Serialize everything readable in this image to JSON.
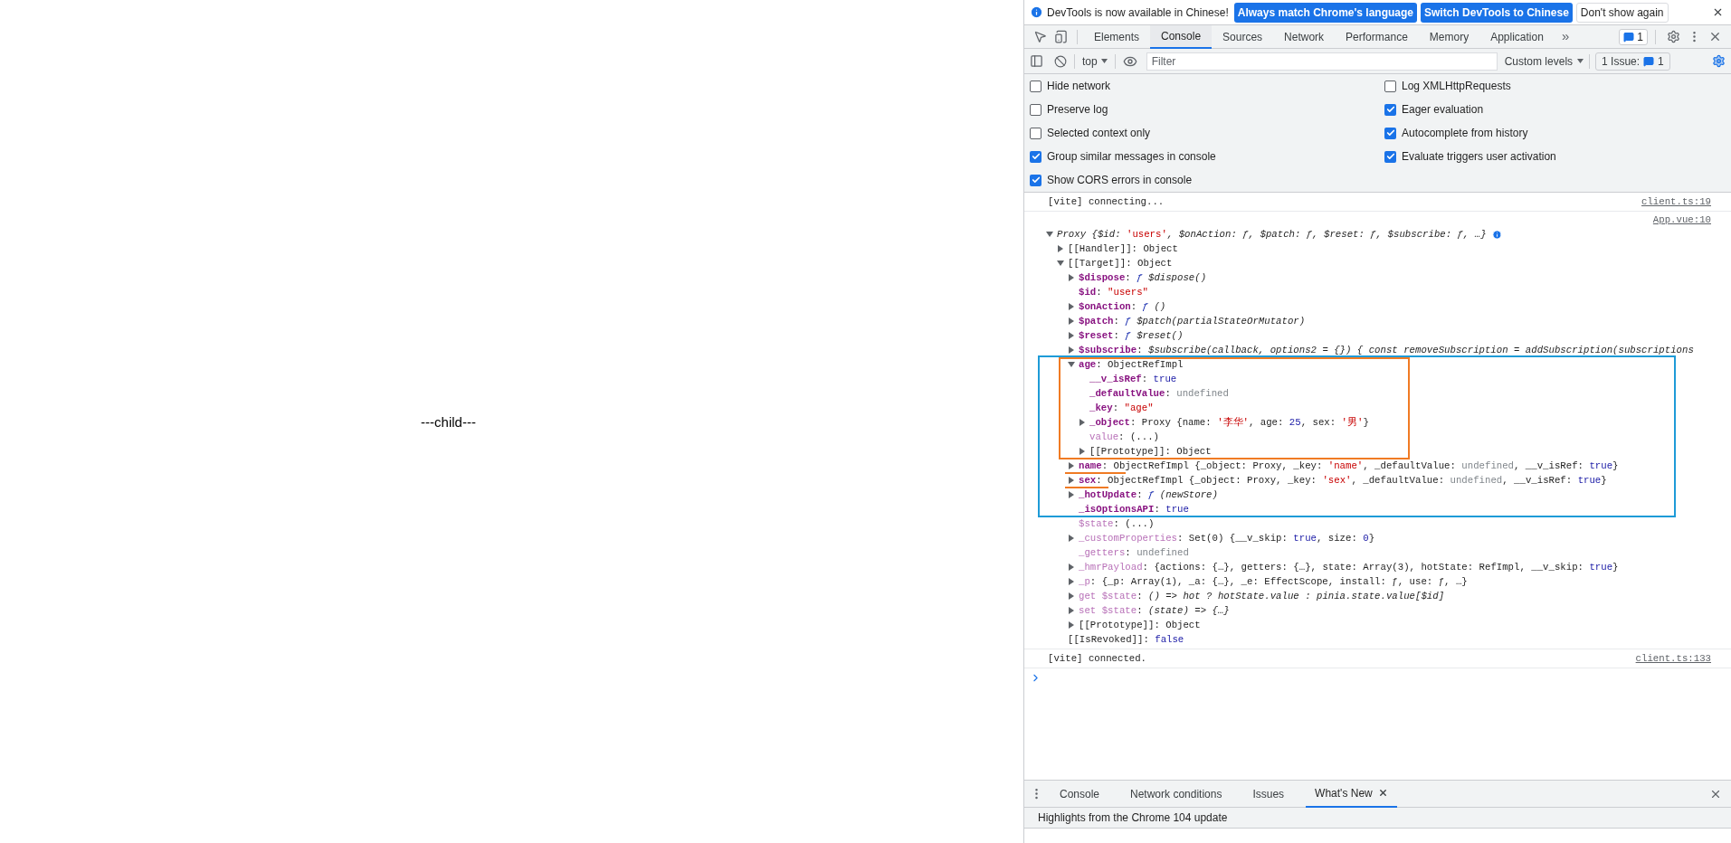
{
  "page": {
    "text": "---child---"
  },
  "devtools": {
    "infobar": {
      "message": "DevTools is now available in Chinese!",
      "buttons": [
        {
          "label": "Always match Chrome's language",
          "kind": "primary"
        },
        {
          "label": "Switch DevTools to Chinese",
          "kind": "primary"
        },
        {
          "label": "Don't show again",
          "kind": "secondary"
        }
      ]
    },
    "tabs": [
      {
        "label": "Elements",
        "selected": false
      },
      {
        "label": "Console",
        "selected": true
      },
      {
        "label": "Sources",
        "selected": false
      },
      {
        "label": "Network",
        "selected": false
      },
      {
        "label": "Performance",
        "selected": false
      },
      {
        "label": "Memory",
        "selected": false
      },
      {
        "label": "Application",
        "selected": false
      }
    ],
    "more_tabs": "»",
    "issues_badge": "1",
    "toolbar": {
      "context": "top",
      "filter_placeholder": "Filter",
      "levels": "Custom levels",
      "issues_label": "1 Issue:",
      "issues_count": "1"
    },
    "settings": {
      "left": [
        {
          "label": "Hide network",
          "checked": false
        },
        {
          "label": "Preserve log",
          "checked": false
        },
        {
          "label": "Selected context only",
          "checked": false
        },
        {
          "label": "Group similar messages in console",
          "checked": true
        },
        {
          "label": "Show CORS errors in console",
          "checked": true
        }
      ],
      "right": [
        {
          "label": "Log XMLHttpRequests",
          "checked": false
        },
        {
          "label": "Eager evaluation",
          "checked": true
        },
        {
          "label": "Autocomplete from history",
          "checked": true
        },
        {
          "label": "Evaluate triggers user activation",
          "checked": true
        }
      ]
    },
    "console": {
      "messages": [
        {
          "kind": "log",
          "text": "[vite] connecting...",
          "source": "client.ts:19"
        },
        {
          "kind": "object",
          "source": "App.vue:10",
          "tree": {
            "kind": "expandable",
            "expanded": true,
            "line": [
              {
                "text": "Proxy {$id: ",
                "kind": "italic"
              },
              {
                "text": "'users'",
                "kind": "string"
              },
              {
                "text": ", $onAction: ƒ, $patch: ƒ, $reset: ƒ, $subscribe: ƒ, …}",
                "kind": "italic"
              }
            ],
            "children": [
              {
                "kind": "expandable",
                "expanded": false,
                "line": [
                  {
                    "text": "[[Handler]]",
                    "kind": "key_internal"
                  },
                  {
                    "text": ": Object",
                    "kind": "plain"
                  }
                ]
              },
              {
                "kind": "expandable",
                "expanded": true,
                "line": [
                  {
                    "text": "[[Target]]",
                    "kind": "key_internal"
                  },
                  {
                    "text": ": Object",
                    "kind": "plain"
                  }
                ],
                "children": [
                  {
                    "kind": "expandable",
                    "expanded": false,
                    "line": [
                      {
                        "text": "$dispose",
                        "kind": "key_own"
                      },
                      {
                        "text": ": ",
                        "kind": "plain"
                      },
                      {
                        "text": "ƒ ",
                        "kind": "fn"
                      },
                      {
                        "text": "$dispose()",
                        "kind": "italic"
                      }
                    ]
                  },
                  {
                    "kind": "leaf",
                    "line": [
                      {
                        "text": "$id",
                        "kind": "key_own"
                      },
                      {
                        "text": ": ",
                        "kind": "plain"
                      },
                      {
                        "text": "\"users\"",
                        "kind": "string"
                      }
                    ]
                  },
                  {
                    "kind": "expandable",
                    "expanded": false,
                    "line": [
                      {
                        "text": "$onAction",
                        "kind": "key_own"
                      },
                      {
                        "text": ": ",
                        "kind": "plain"
                      },
                      {
                        "text": "ƒ ",
                        "kind": "fn"
                      },
                      {
                        "text": "()",
                        "kind": "italic"
                      }
                    ]
                  },
                  {
                    "kind": "expandable",
                    "expanded": false,
                    "line": [
                      {
                        "text": "$patch",
                        "kind": "key_own"
                      },
                      {
                        "text": ": ",
                        "kind": "plain"
                      },
                      {
                        "text": "ƒ ",
                        "kind": "fn"
                      },
                      {
                        "text": "$patch(partialStateOrMutator)",
                        "kind": "italic"
                      }
                    ]
                  },
                  {
                    "kind": "expandable",
                    "expanded": false,
                    "line": [
                      {
                        "text": "$reset",
                        "kind": "key_own"
                      },
                      {
                        "text": ": ",
                        "kind": "plain"
                      },
                      {
                        "text": "ƒ ",
                        "kind": "fn"
                      },
                      {
                        "text": "$reset()",
                        "kind": "italic"
                      }
                    ]
                  },
                  {
                    "kind": "expandable",
                    "expanded": false,
                    "line": [
                      {
                        "text": "$subscribe",
                        "kind": "key_own"
                      },
                      {
                        "text": ": ",
                        "kind": "plain"
                      },
                      {
                        "text": "$subscribe(callback, options2 = {}) { const removeSubscription = addSubscription(subscriptions",
                        "kind": "italic"
                      }
                    ]
                  },
                  {
                    "kind": "expandable",
                    "expanded": true,
                    "line": [
                      {
                        "text": "age",
                        "kind": "key_own"
                      },
                      {
                        "text": ": ObjectRefImpl",
                        "kind": "plain"
                      }
                    ],
                    "children": [
                      {
                        "kind": "leaf",
                        "line": [
                          {
                            "text": "__v_isRef",
                            "kind": "key_own"
                          },
                          {
                            "text": ": ",
                            "kind": "plain"
                          },
                          {
                            "text": "true",
                            "kind": "keyword"
                          }
                        ]
                      },
                      {
                        "kind": "leaf",
                        "line": [
                          {
                            "text": "_defaultValue",
                            "kind": "key_own"
                          },
                          {
                            "text": ": ",
                            "kind": "plain"
                          },
                          {
                            "text": "undefined",
                            "kind": "undefined"
                          }
                        ]
                      },
                      {
                        "kind": "leaf",
                        "line": [
                          {
                            "text": "_key",
                            "kind": "key_own"
                          },
                          {
                            "text": ": ",
                            "kind": "plain"
                          },
                          {
                            "text": "\"age\"",
                            "kind": "string"
                          }
                        ]
                      },
                      {
                        "kind": "expandable",
                        "expanded": false,
                        "line": [
                          {
                            "text": "_object",
                            "kind": "key_own"
                          },
                          {
                            "text": ": Proxy {name: ",
                            "kind": "plain"
                          },
                          {
                            "text": "'李华'",
                            "kind": "string"
                          },
                          {
                            "text": ", age: ",
                            "kind": "plain"
                          },
                          {
                            "text": "25",
                            "kind": "number"
                          },
                          {
                            "text": ", sex: ",
                            "kind": "plain"
                          },
                          {
                            "text": "'男'",
                            "kind": "string"
                          },
                          {
                            "text": "}",
                            "kind": "plain"
                          }
                        ]
                      },
                      {
                        "kind": "leaf",
                        "line": [
                          {
                            "text": "value",
                            "kind": "key_faded"
                          },
                          {
                            "text": ": (...)",
                            "kind": "plain"
                          }
                        ]
                      },
                      {
                        "kind": "expandable",
                        "expanded": false,
                        "line": [
                          {
                            "text": "[[Prototype]]",
                            "kind": "key_internal"
                          },
                          {
                            "text": ": Object",
                            "kind": "plain"
                          }
                        ]
                      }
                    ]
                  },
                  {
                    "kind": "expandable",
                    "expanded": false,
                    "line": [
                      {
                        "text": "name",
                        "kind": "key_own"
                      },
                      {
                        "text": ": ObjectRefImpl {_object: Proxy, _key: ",
                        "kind": "plain"
                      },
                      {
                        "text": "'name'",
                        "kind": "string"
                      },
                      {
                        "text": ", _defaultValue: ",
                        "kind": "plain"
                      },
                      {
                        "text": "undefined",
                        "kind": "undefined"
                      },
                      {
                        "text": ", __v_isRef: ",
                        "kind": "plain"
                      },
                      {
                        "text": "true",
                        "kind": "keyword"
                      },
                      {
                        "text": "}",
                        "kind": "plain"
                      }
                    ]
                  },
                  {
                    "kind": "expandable",
                    "expanded": false,
                    "line": [
                      {
                        "text": "sex",
                        "kind": "key_own"
                      },
                      {
                        "text": ": ObjectRefImpl {_object: Proxy, _key: ",
                        "kind": "plain"
                      },
                      {
                        "text": "'sex'",
                        "kind": "string"
                      },
                      {
                        "text": ", _defaultValue: ",
                        "kind": "plain"
                      },
                      {
                        "text": "undefined",
                        "kind": "undefined"
                      },
                      {
                        "text": ", __v_isRef: ",
                        "kind": "plain"
                      },
                      {
                        "text": "true",
                        "kind": "keyword"
                      },
                      {
                        "text": "}",
                        "kind": "plain"
                      }
                    ]
                  },
                  {
                    "kind": "expandable",
                    "expanded": false,
                    "line": [
                      {
                        "text": "_hotUpdate",
                        "kind": "key_own"
                      },
                      {
                        "text": ": ",
                        "kind": "plain"
                      },
                      {
                        "text": "ƒ ",
                        "kind": "fn"
                      },
                      {
                        "text": "(newStore)",
                        "kind": "italic"
                      }
                    ]
                  },
                  {
                    "kind": "leaf",
                    "line": [
                      {
                        "text": "_isOptionsAPI",
                        "kind": "key_own"
                      },
                      {
                        "text": ": ",
                        "kind": "plain"
                      },
                      {
                        "text": "true",
                        "kind": "keyword"
                      }
                    ]
                  },
                  {
                    "kind": "leaf",
                    "line": [
                      {
                        "text": "$state",
                        "kind": "key_faded"
                      },
                      {
                        "text": ": (...)",
                        "kind": "plain"
                      }
                    ]
                  },
                  {
                    "kind": "expandable",
                    "expanded": false,
                    "line": [
                      {
                        "text": "_customProperties",
                        "kind": "key_faded"
                      },
                      {
                        "text": ": Set(0) {__v_skip: ",
                        "kind": "plain"
                      },
                      {
                        "text": "true",
                        "kind": "keyword"
                      },
                      {
                        "text": ", size: ",
                        "kind": "plain"
                      },
                      {
                        "text": "0",
                        "kind": "number"
                      },
                      {
                        "text": "}",
                        "kind": "plain"
                      }
                    ]
                  },
                  {
                    "kind": "leaf",
                    "line": [
                      {
                        "text": "_getters",
                        "kind": "key_faded"
                      },
                      {
                        "text": ": ",
                        "kind": "plain"
                      },
                      {
                        "text": "undefined",
                        "kind": "undefined"
                      }
                    ]
                  },
                  {
                    "kind": "expandable",
                    "expanded": false,
                    "line": [
                      {
                        "text": "_hmrPayload",
                        "kind": "key_faded"
                      },
                      {
                        "text": ": {actions: {…}, getters: {…}, state: Array(3), hotState: RefImpl, __v_skip: ",
                        "kind": "plain"
                      },
                      {
                        "text": "true",
                        "kind": "keyword"
                      },
                      {
                        "text": "}",
                        "kind": "plain"
                      }
                    ]
                  },
                  {
                    "kind": "expandable",
                    "expanded": false,
                    "line": [
                      {
                        "text": "_p",
                        "kind": "key_faded"
                      },
                      {
                        "text": ": {_p: Array(1), _a: {…}, _e: EffectScope, install: ƒ, use: ƒ, …}",
                        "kind": "plain"
                      }
                    ]
                  },
                  {
                    "kind": "expandable",
                    "expanded": false,
                    "line": [
                      {
                        "text": "get $state",
                        "kind": "key_faded"
                      },
                      {
                        "text": ": ",
                        "kind": "plain"
                      },
                      {
                        "text": "() => hot ? hotState.value : pinia.state.value[$id]",
                        "kind": "italic"
                      }
                    ]
                  },
                  {
                    "kind": "expandable",
                    "expanded": false,
                    "line": [
                      {
                        "text": "set $state",
                        "kind": "key_faded"
                      },
                      {
                        "text": ": ",
                        "kind": "plain"
                      },
                      {
                        "text": "(state) => {…}",
                        "kind": "italic"
                      }
                    ]
                  },
                  {
                    "kind": "expandable",
                    "expanded": false,
                    "line": [
                      {
                        "text": "[[Prototype]]",
                        "kind": "key_internal"
                      },
                      {
                        "text": ": Object",
                        "kind": "plain"
                      }
                    ]
                  }
                ]
              },
              {
                "kind": "leaf",
                "line": [
                  {
                    "text": "[[IsRevoked]]",
                    "kind": "key_internal"
                  },
                  {
                    "text": ": ",
                    "kind": "plain"
                  },
                  {
                    "text": "false",
                    "kind": "keyword"
                  }
                ]
              }
            ]
          }
        },
        {
          "kind": "log",
          "text": "[vite] connected.",
          "source": "client.ts:133"
        }
      ]
    },
    "drawer": {
      "tabs": [
        {
          "label": "Console",
          "selected": false,
          "closable": false
        },
        {
          "label": "Network conditions",
          "selected": false,
          "closable": false
        },
        {
          "label": "Issues",
          "selected": false,
          "closable": false
        },
        {
          "label": "What's New",
          "selected": true,
          "closable": true
        }
      ],
      "content": "Highlights from the Chrome 104 update"
    }
  }
}
